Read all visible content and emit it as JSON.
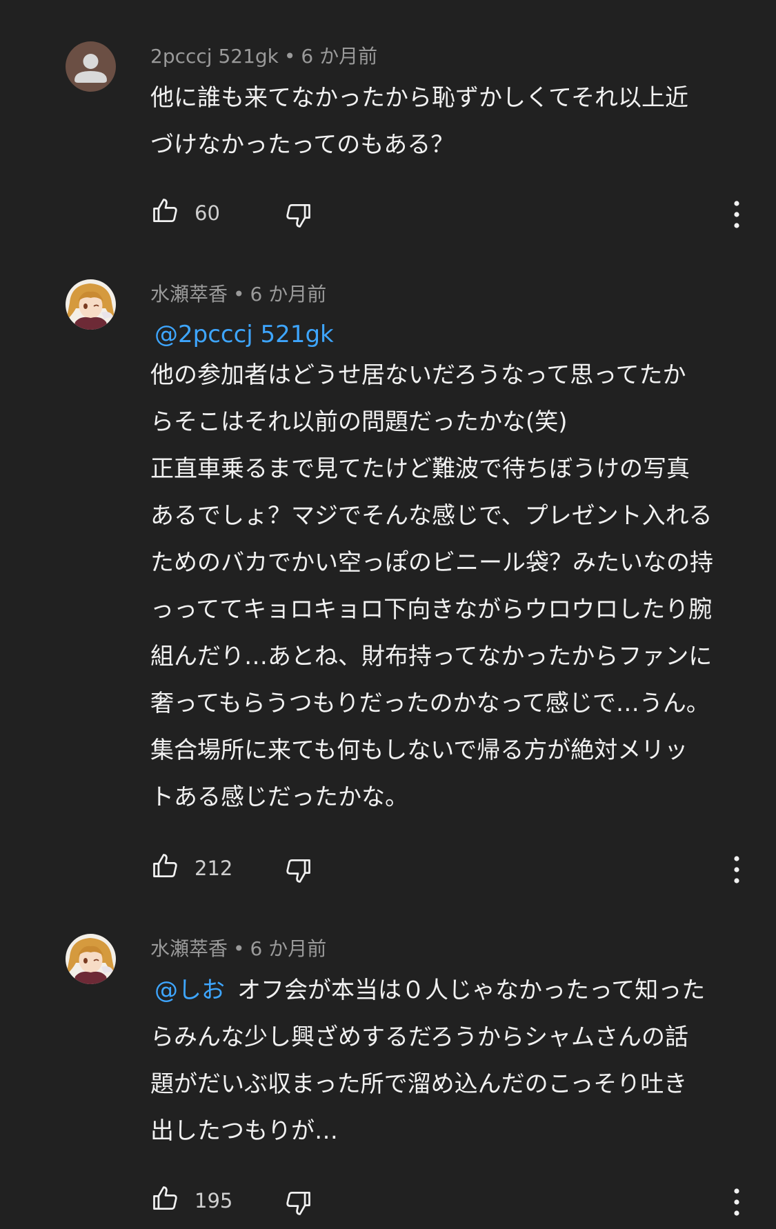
{
  "comments": [
    {
      "author": "2pcccj 521gk",
      "separator": "•",
      "time": "6 か月前",
      "avatar": "default-person-avatar",
      "lines": [
        "他に誰も来てなかったから恥ずかしくてそれ以上近",
        "づけなかったってのもある？"
      ],
      "likes": "60"
    },
    {
      "author": "水瀬萃香",
      "separator": "•",
      "time": "6 か月前",
      "avatar": "anime-character-avatar",
      "mention": "@2pcccj 521gk",
      "lines": [
        "他の参加者はどうせ居ないだろうなって思ってたか",
        "らそこはそれ以前の問題だったかな(笑)",
        "正直車乗るまで見てたけど難波で待ちぼうけの写真",
        "あるでしょ？マジでそんな感じで、プレゼント入れる",
        "ためのバカでかい空っぽのビニール袋？みたいなの持",
        "っっててキョロキョロ下向きながらウロウロしたり腕",
        "組んだり…あとね、財布持ってなかったからファンに",
        "奢ってもらうつもりだったのかなって感じで…うん。",
        "集合場所に来ても何もしないで帰る方が絶対メリッ",
        "トある感じだったかな。"
      ],
      "likes": "212"
    },
    {
      "author": "水瀬萃香",
      "separator": "•",
      "time": "6 か月前",
      "avatar": "anime-character-avatar",
      "mention": "@しお",
      "lines": [
        "オフ会が本当は０人じゃなかったって知った",
        "らみんな少し興ざめするだろうからシャムさんの話",
        "題がだいぶ収まった所で溜め込んだのこっそり吐き",
        "出したつもりが…"
      ],
      "likes": "195"
    }
  ],
  "icons": {
    "like": "thumbs-up-icon",
    "dislike": "thumbs-down-icon",
    "more": "more-vertical-icon"
  },
  "colors": {
    "background": "#212121",
    "text": "#f1f1f1",
    "meta": "#9a9a9a",
    "mention": "#3ea6ff"
  }
}
